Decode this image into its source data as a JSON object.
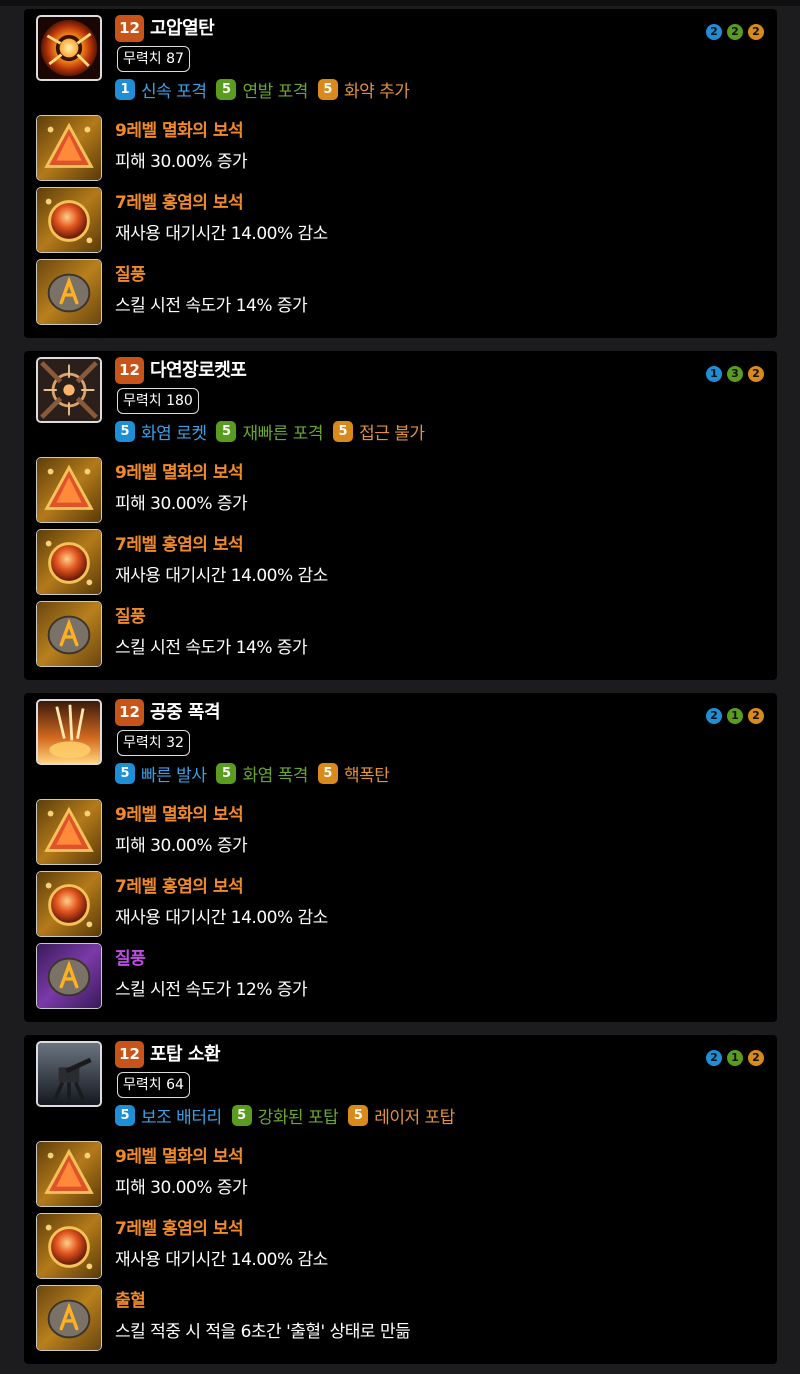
{
  "colors": {
    "level_badge": "#c9541a",
    "tripod_blue": "#1e8fd6",
    "tripod_green": "#5a9c1f",
    "tripod_orange": "#d98a1a",
    "gem_title": "#f08a2a",
    "rune_legendary": "#f08a2a",
    "rune_epic": "#c04ee6"
  },
  "skills": [
    {
      "level": "12",
      "name": "고압열탄",
      "stagger": "무력치 87",
      "icon": "explosion-icon",
      "tripods": [
        {
          "level": "1",
          "name": "신속 포격"
        },
        {
          "level": "5",
          "name": "연발 포격"
        },
        {
          "level": "5",
          "name": "화약 추가"
        }
      ],
      "tripod_dots": [
        "2",
        "2",
        "2"
      ],
      "gems": [
        {
          "title": "9레벨 멸화의 보석",
          "desc": "피해 30.00% 증가"
        },
        {
          "title": "7레벨 홍염의 보석",
          "desc": "재사용 대기시간 14.00% 감소"
        }
      ],
      "rune": {
        "title": "질풍",
        "desc": "스킬 시전 속도가 14% 증가",
        "grade": "legendary"
      }
    },
    {
      "level": "12",
      "name": "다연장로켓포",
      "stagger": "무력치 180",
      "icon": "crosshair-icon",
      "tripods": [
        {
          "level": "5",
          "name": "화염 로켓"
        },
        {
          "level": "5",
          "name": "재빠른 포격"
        },
        {
          "level": "5",
          "name": "접근 불가"
        }
      ],
      "tripod_dots": [
        "1",
        "3",
        "2"
      ],
      "gems": [
        {
          "title": "9레벨 멸화의 보석",
          "desc": "피해 30.00% 증가"
        },
        {
          "title": "7레벨 홍염의 보석",
          "desc": "재사용 대기시간 14.00% 감소"
        }
      ],
      "rune": {
        "title": "질풍",
        "desc": "스킬 시전 속도가 14% 증가",
        "grade": "legendary"
      }
    },
    {
      "level": "12",
      "name": "공중 폭격",
      "stagger": "무력치 32",
      "icon": "airstrike-icon",
      "tripods": [
        {
          "level": "5",
          "name": "빠른 발사"
        },
        {
          "level": "5",
          "name": "화염 폭격"
        },
        {
          "level": "5",
          "name": "핵폭탄"
        }
      ],
      "tripod_dots": [
        "2",
        "1",
        "2"
      ],
      "gems": [
        {
          "title": "9레벨 멸화의 보석",
          "desc": "피해 30.00% 증가"
        },
        {
          "title": "7레벨 홍염의 보석",
          "desc": "재사용 대기시간 14.00% 감소"
        }
      ],
      "rune": {
        "title": "질풍",
        "desc": "스킬 시전 속도가 12% 증가",
        "grade": "epic"
      }
    },
    {
      "level": "12",
      "name": "포탑 소환",
      "stagger": "무력치 64",
      "icon": "turret-icon",
      "tripods": [
        {
          "level": "5",
          "name": "보조 배터리"
        },
        {
          "level": "5",
          "name": "강화된 포탑"
        },
        {
          "level": "5",
          "name": "레이저 포탑"
        }
      ],
      "tripod_dots": [
        "2",
        "1",
        "2"
      ],
      "gems": [
        {
          "title": "9레벨 멸화의 보석",
          "desc": "피해 30.00% 증가"
        },
        {
          "title": "7레벨 홍염의 보석",
          "desc": "재사용 대기시간 14.00% 감소"
        }
      ],
      "rune": {
        "title": "출혈",
        "desc": "스킬 적중 시 적을 6초간 '출혈' 상태로 만듦",
        "grade": "legendary"
      }
    }
  ]
}
